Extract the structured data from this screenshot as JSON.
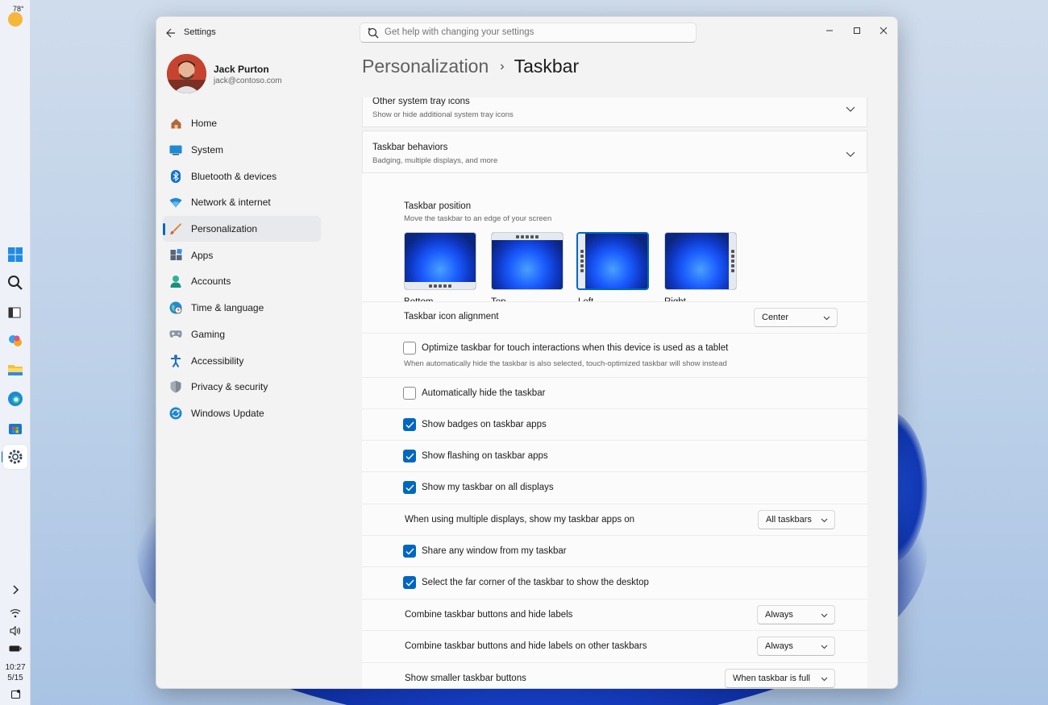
{
  "taskbar": {
    "temperature": "78°",
    "time": "10:27",
    "date": "5/15"
  },
  "window": {
    "app_title": "Settings"
  },
  "search": {
    "placeholder": "Get help with changing your settings"
  },
  "profile": {
    "name": "Jack Purton",
    "email": "jack@contoso.com"
  },
  "sidebar": {
    "items": [
      {
        "label": "Home",
        "icon": "home-icon"
      },
      {
        "label": "System",
        "icon": "system-icon"
      },
      {
        "label": "Bluetooth & devices",
        "icon": "bluetooth-icon"
      },
      {
        "label": "Network & internet",
        "icon": "network-icon"
      },
      {
        "label": "Personalization",
        "icon": "brush-icon",
        "active": true
      },
      {
        "label": "Apps",
        "icon": "apps-icon"
      },
      {
        "label": "Accounts",
        "icon": "accounts-icon"
      },
      {
        "label": "Time & language",
        "icon": "globe-icon"
      },
      {
        "label": "Gaming",
        "icon": "gamepad-icon"
      },
      {
        "label": "Accessibility",
        "icon": "accessibility-icon"
      },
      {
        "label": "Privacy & security",
        "icon": "shield-icon"
      },
      {
        "label": "Windows Update",
        "icon": "update-icon"
      }
    ]
  },
  "breadcrumb": {
    "parent": "Personalization",
    "separator": "›",
    "current": "Taskbar"
  },
  "sections": {
    "tray": {
      "title": "Other system tray icons",
      "subtitle": "Show or hide additional system tray icons"
    },
    "behaviors": {
      "title": "Taskbar behaviors",
      "subtitle": "Badging, multiple displays, and more"
    }
  },
  "position": {
    "title": "Taskbar position",
    "subtitle": "Move the taskbar to an edge of your screen",
    "options": [
      "Bottom",
      "Top",
      "Left",
      "Right"
    ],
    "selected": "Left"
  },
  "settings": {
    "alignment": {
      "label": "Taskbar icon alignment",
      "value": "Center"
    },
    "touch": {
      "label": "Optimize taskbar for touch interactions when this device is used as a tablet",
      "note": "When automatically hide the taskbar is also selected, touch-optimized taskbar will show instead",
      "checked": false
    },
    "autohide": {
      "label": "Automatically hide the taskbar",
      "checked": false
    },
    "badges": {
      "label": "Show badges on taskbar apps",
      "checked": true
    },
    "flashing": {
      "label": "Show flashing on taskbar apps",
      "checked": true
    },
    "all_displays": {
      "label": "Show my taskbar on all displays",
      "checked": true
    },
    "multi_display": {
      "label": "When using multiple displays, show my taskbar apps on",
      "value": "All taskbars"
    },
    "share_window": {
      "label": "Share any window from my taskbar",
      "checked": true
    },
    "far_corner": {
      "label": "Select the far corner of the taskbar to show the desktop",
      "checked": true
    },
    "combine": {
      "label": "Combine taskbar buttons and hide labels",
      "value": "Always"
    },
    "combine_other": {
      "label": "Combine taskbar buttons and hide labels on other taskbars",
      "value": "Always"
    },
    "smaller": {
      "label": "Show smaller taskbar buttons",
      "value": "When taskbar is full"
    }
  },
  "colors": {
    "accent": "#0067c0",
    "window_bg": "#f3f3f3",
    "card_bg": "#fbfbfb"
  }
}
